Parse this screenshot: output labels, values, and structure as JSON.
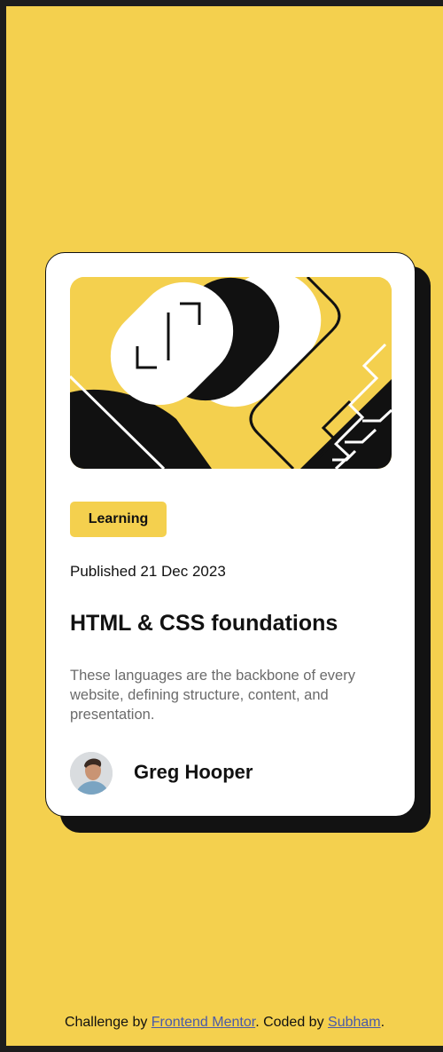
{
  "card": {
    "tag": "Learning",
    "published": "Published 21 Dec 2023",
    "title": "HTML & CSS foundations",
    "description": "These languages are the backbone of every website, defining structure, content, and presentation.",
    "author": "Greg Hooper"
  },
  "footer": {
    "prefix": "Challenge by ",
    "link1": "Frontend Mentor",
    "middle": ". Coded by ",
    "link2": "Subham",
    "suffix": "."
  },
  "colors": {
    "accent": "#f4d04e",
    "ink": "#111111",
    "muted": "#6b6b6b",
    "link": "#4a5aa8"
  },
  "icons": [
    "blog-illustration",
    "author-avatar"
  ]
}
